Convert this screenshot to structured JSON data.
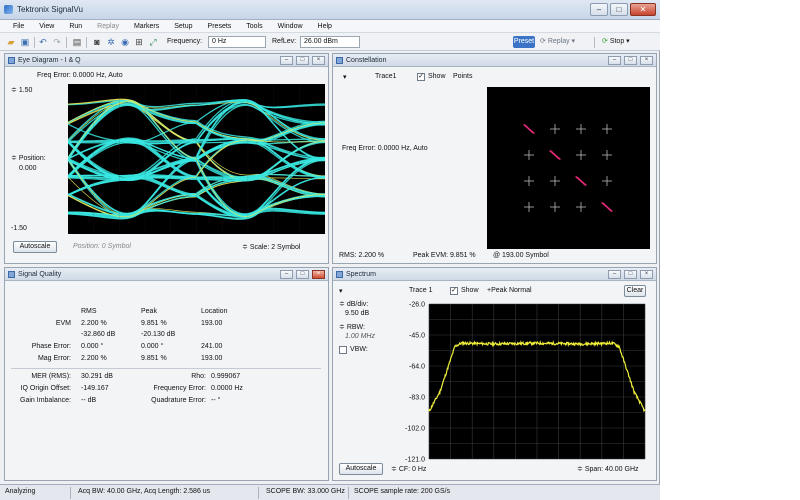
{
  "window": {
    "title": "Tektronix SignalVu",
    "minimize": "–",
    "maximize": "□",
    "close": "✕"
  },
  "menu": [
    "File",
    "View",
    "Run",
    "Replay",
    "Markers",
    "Setup",
    "Presets",
    "Tools",
    "Window",
    "Help"
  ],
  "toolbar": {
    "frequency_label": "Frequency:",
    "frequency_value": "0 Hz",
    "reflev_label": "RefLev:",
    "reflev_value": "26.00 dBm",
    "preset_label": "Preset",
    "replay_label": "Replay",
    "stop_label": "Stop"
  },
  "eye_diagram": {
    "title": "Eye Diagram - I & Q",
    "freq_error": "Freq Error: 0.0000 Hz, Auto",
    "top_value": "1.50",
    "position_label": "Position:",
    "position_value": "0.000",
    "bottom_value": "-1.50",
    "autoscale_label": "Autoscale",
    "x_position": "Position:  0 Symbol",
    "scale": "Scale:  2 Symbol",
    "trace_color": "#38e8e2",
    "edge_color": "#e9e85a"
  },
  "constellation": {
    "title": "Constellation",
    "trace": "Trace1",
    "show_label": "Show",
    "show_mode": "Points",
    "freq_error": "Freq Error: 0.0000 Hz, Auto",
    "rms": "RMS: 2.200 %",
    "peak_evm": "Peak EVM: 9.851 %",
    "symbol": "@ 193.00 Symbol",
    "point_color": "#e8287a"
  },
  "signal_quality": {
    "title": "Signal Quality",
    "headers": [
      "RMS",
      "Peak",
      "Location"
    ],
    "rows": [
      {
        "label": "EVM",
        "rms": "2.200 %",
        "peak": "9.851 %",
        "location": "193.00"
      },
      {
        "label": "",
        "rms": "-32.860 dB",
        "peak": "-20.130 dB",
        "location": ""
      },
      {
        "label": "Phase Error:",
        "rms": "0.000 °",
        "peak": "0.000 °",
        "location": "241.00"
      },
      {
        "label": "Mag Error:",
        "rms": "2.200 %",
        "peak": "9.851 %",
        "location": "193.00"
      }
    ],
    "mer_label": "MER (RMS):",
    "mer_value": "30.291 dB",
    "rho_label": "Rho:",
    "rho_value": "0.999067",
    "iq_label": "IQ Origin Offset:",
    "iq_value": "-149.167",
    "freq_err_label": "Frequency Error:",
    "freq_err_value": "0.0000 Hz",
    "gain_label": "Gain Imbalance:",
    "gain_value": "-- dB",
    "quad_label": "Quadrature Error:",
    "quad_value": "-- °"
  },
  "spectrum": {
    "title": "Spectrum",
    "trace": "Trace 1",
    "show_label": "Show",
    "detector": "+Peak Normal",
    "clear_label": "Clear",
    "db_div_label": "dB/div:",
    "db_div_value": "9.50 dB",
    "rbw_label": "RBW:",
    "rbw_value": "1.00 MHz",
    "vbw_label": "VBW:",
    "y_ticks": [
      "-26.0",
      "-45.0",
      "-64.0",
      "-83.0",
      "-102.0",
      "-121.0"
    ],
    "autoscale_label": "Autoscale",
    "cf": "CF: 0 Hz",
    "span": "Span: 40.00 GHz",
    "trace_color": "#f0ef3a"
  },
  "chart_data": {
    "type": "line",
    "title": "Spectrum",
    "xlabel": "",
    "ylabel": "",
    "y_unit": "dBm",
    "ylim": [
      -121.0,
      -26.0
    ],
    "y_ticks": [
      -26.0,
      -45.0,
      -64.0,
      -83.0,
      -102.0,
      -121.0
    ],
    "center_frequency": "0 Hz",
    "span": "40.00 GHz",
    "series": [
      {
        "x_fraction": [
          0.0,
          0.02,
          0.05,
          0.1,
          0.12,
          0.15,
          0.3,
          0.5,
          0.7,
          0.85,
          0.88,
          0.9,
          0.95,
          0.98,
          1.0
        ],
        "values": [
          -92.0,
          -87.0,
          -80.0,
          -60.0,
          -52.0,
          -50.0,
          -50.5,
          -50.0,
          -50.5,
          -50.0,
          -52.0,
          -60.0,
          -80.0,
          -87.0,
          -92.0
        ]
      }
    ]
  },
  "status": {
    "state": "Analyzing",
    "acq": "Acq BW: 40.00 GHz, Acq Length: 2.586 us",
    "scope_bw": "SCOPE BW: 33.000 GHz",
    "scope_rate": "SCOPE sample rate: 200 GS/s"
  }
}
